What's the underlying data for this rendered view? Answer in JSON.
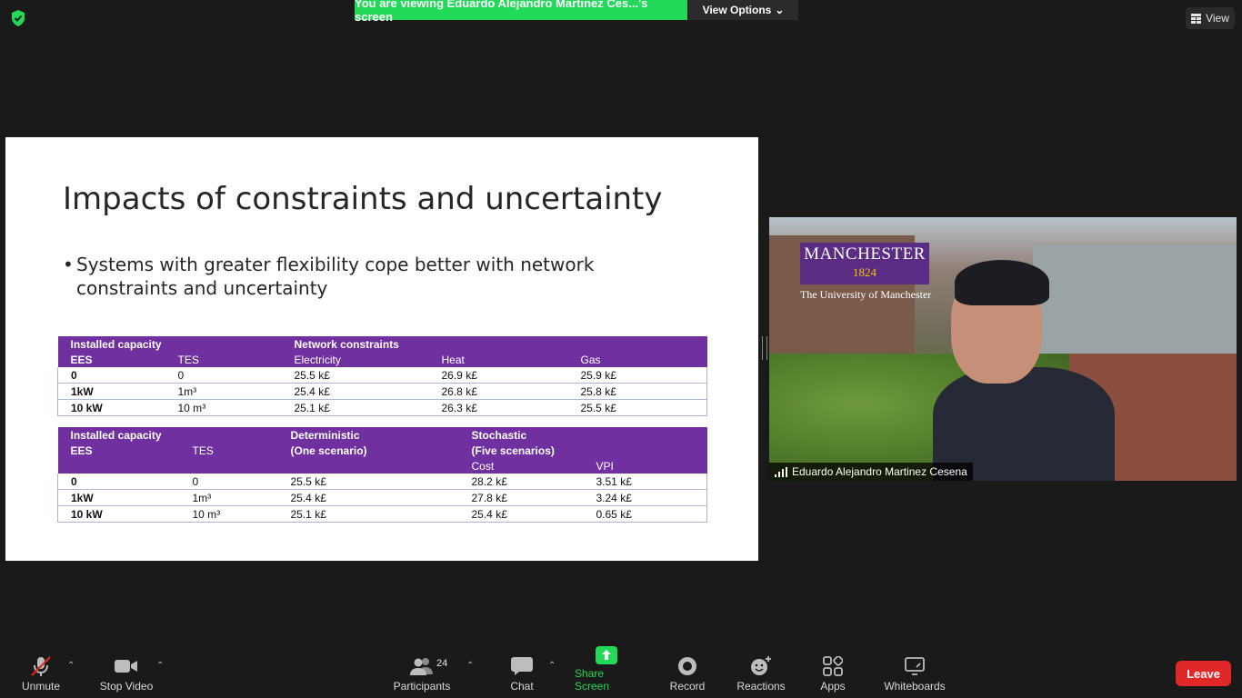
{
  "top": {
    "banner": "You are viewing Eduardo Alejandro Martinez Ces...'s screen",
    "view_options": "View Options",
    "view": "View"
  },
  "slide": {
    "title": "Impacts of constraints and uncertainty",
    "bullet": "Systems with greater flexibility cope better with network constraints and uncertainty",
    "table1": {
      "header_row1": [
        "Installed capacity",
        "",
        "Network constraints",
        "",
        ""
      ],
      "header_row2": [
        "EES",
        "TES",
        "Electricity",
        "Heat",
        "Gas"
      ],
      "rows": [
        [
          "0",
          "0",
          "25.5 k£",
          "26.9 k£",
          "25.9 k£"
        ],
        [
          "1kW",
          "1m³",
          "25.4 k£",
          "26.8 k£",
          "25.8 k£"
        ],
        [
          "10 kW",
          "10 m³",
          "25.1 k£",
          "26.3 k£",
          "25.5 k£"
        ]
      ]
    },
    "table2": {
      "header_row1": [
        "Installed capacity",
        "",
        "Deterministic",
        "Stochastic",
        ""
      ],
      "header_row2": [
        "EES",
        "TES",
        "(One scenario)",
        "(Five  scenarios)",
        ""
      ],
      "header_row3": [
        "",
        "",
        "",
        "Cost",
        "VPI"
      ],
      "rows": [
        [
          "0",
          "0",
          "25.5 k£",
          "28.2 k£",
          "3.51 k£"
        ],
        [
          "1kW",
          "1m³",
          "25.4 k£",
          "27.8 k£",
          "3.24 k£"
        ],
        [
          "10 kW",
          "10 m³",
          "25.1 k£",
          "25.4 k£",
          "0.65 k£"
        ]
      ]
    }
  },
  "video": {
    "logo_word": "MANCHESTER",
    "logo_year": "1824",
    "logo_sub": "The University of Manchester",
    "participant_name": "Eduardo Alejandro Martinez Cesena"
  },
  "toolbar": {
    "unmute": "Unmute",
    "stop_video": "Stop Video",
    "participants": "Participants",
    "participants_count": "24",
    "chat": "Chat",
    "share_screen": "Share Screen",
    "record": "Record",
    "reactions": "Reactions",
    "apps": "Apps",
    "whiteboards": "Whiteboards",
    "leave": "Leave"
  },
  "colors": {
    "accent_green": "#23d959",
    "table_purple": "#7030a0",
    "leave_red": "#e02828"
  }
}
